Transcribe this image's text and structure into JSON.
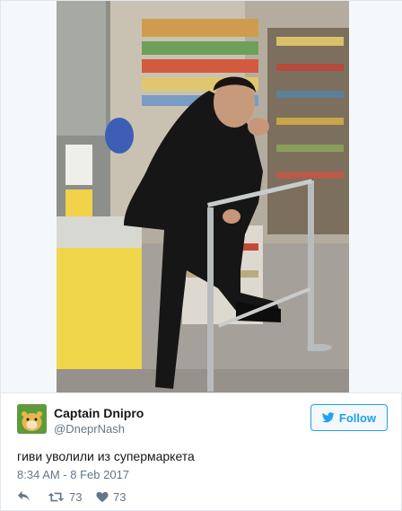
{
  "tweet": {
    "author": {
      "name": "Captain Dnipro",
      "handle": "@DneprNash"
    },
    "follow_label": "Follow",
    "text": "гиви уволили из супермаркета",
    "timestamp": "8:34 AM - 8 Feb 2017",
    "retweet_count": "73",
    "like_count": "73"
  },
  "icons": {
    "follow": "twitter-bird-icon",
    "reply": "reply-icon",
    "retweet": "retweet-icon",
    "like": "heart-icon"
  },
  "colors": {
    "accent": "#1da1f2",
    "muted": "#657786",
    "text": "#14171a",
    "border": "#e1e8ed"
  }
}
